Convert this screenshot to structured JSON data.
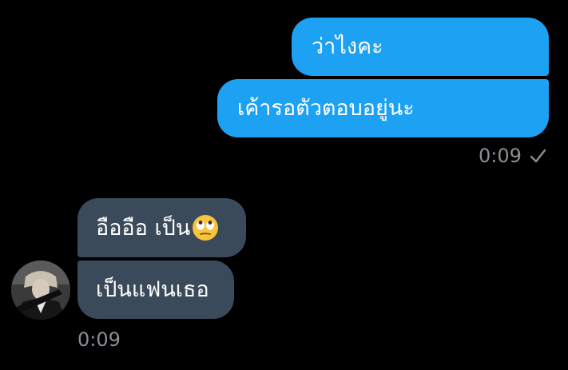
{
  "conversation": {
    "outgoing": {
      "messages": [
        {
          "text": "ว่าไงคะ"
        },
        {
          "text": "เค้ารอตัวตอบอยู่นะ"
        }
      ],
      "timestamp": "0:09",
      "status_icon": "check-icon"
    },
    "incoming": {
      "messages": [
        {
          "text": "อืออือ เป็น",
          "emoji": "face-with-rolling-eyes"
        },
        {
          "text": "เป็นแฟนเธอ"
        }
      ],
      "timestamp": "0:09",
      "avatar": "user-avatar"
    }
  },
  "colors": {
    "background": "#000000",
    "outgoing_bubble": "#1da1f2",
    "incoming_bubble": "#3b4a5a",
    "timestamp": "#8a8f95"
  }
}
